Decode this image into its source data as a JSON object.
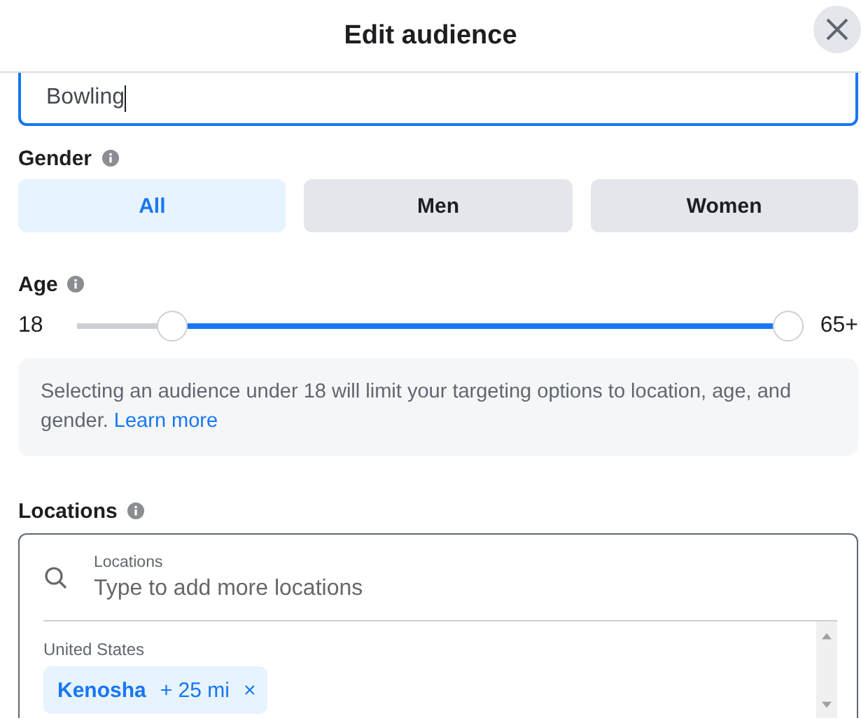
{
  "dialog": {
    "title": "Edit audience"
  },
  "interest_field": {
    "value": "Bowling",
    "focused": true
  },
  "gender": {
    "label": "Gender",
    "options": [
      {
        "label": "All",
        "selected": true
      },
      {
        "label": "Men",
        "selected": false
      },
      {
        "label": "Women",
        "selected": false
      }
    ]
  },
  "age": {
    "label": "Age",
    "min_label": "18",
    "max_label": "65+",
    "thumbs": [
      {
        "level": 0.115
      },
      {
        "level": 1
      }
    ]
  },
  "notice": {
    "text": "Selecting an audience under 18 will limit your targeting options to location, age, and gender.",
    "link": "Learn more"
  },
  "locations": {
    "label": "Locations",
    "field_label": "Locations",
    "placeholder": "Type to add more locations",
    "groups": [
      {
        "country": "United States",
        "chips": [
          {
            "name": "Kenosha",
            "radius": "+ 25 mi",
            "remove": "×"
          }
        ]
      }
    ]
  }
}
